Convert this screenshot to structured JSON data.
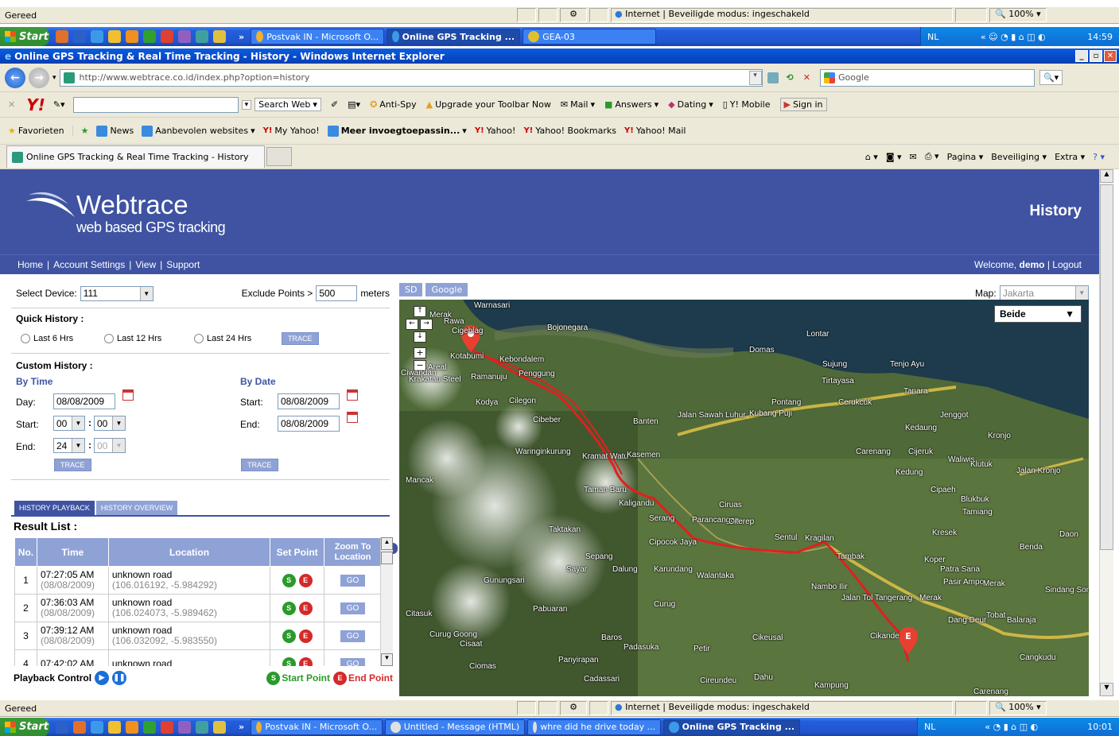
{
  "status_top": {
    "text": "Gereed",
    "zone": "Internet | Beveiligde modus: ingeschakeld",
    "zoom": "100%"
  },
  "taskbar_top": {
    "start": "Start",
    "tasks": [
      "Postvak IN - Microsoft O...",
      "Online GPS Tracking ...",
      "GEA-03"
    ],
    "lang": "NL",
    "clock": "14:59"
  },
  "window": {
    "title": "Online GPS Tracking & Real Time Tracking - History - Windows Internet Explorer"
  },
  "address": {
    "url": "http://www.webtrace.co.id/index.php?option=history",
    "search_placeholder": "Google"
  },
  "yahoo_toolbar": {
    "search_web": "Search Web",
    "anti_spy": "Anti-Spy",
    "upgrade": "Upgrade your Toolbar Now",
    "mail": "Mail",
    "answers": "Answers",
    "dating": "Dating",
    "mobile": "Y! Mobile",
    "signin": "Sign in"
  },
  "favorites": {
    "label": "Favorieten",
    "items": [
      "News",
      "Aanbevolen websites",
      "My Yahoo!",
      "Meer invoegtoepassin...",
      "Yahoo!",
      "Yahoo! Bookmarks",
      "Yahoo! Mail"
    ]
  },
  "tab": {
    "title": "Online GPS Tracking & Real Time Tracking - History",
    "cmd_page": "Pagina",
    "cmd_security": "Beveiliging",
    "cmd_extra": "Extra"
  },
  "site": {
    "brand": "Webtrace",
    "tagline": "web based GPS tracking",
    "page_title": "History",
    "nav": [
      "Home",
      "Account Settings",
      "View",
      "Support"
    ],
    "welcome": "Welcome,",
    "user": "demo",
    "logout": "Logout"
  },
  "form": {
    "select_device_label": "Select Device:",
    "device": "111",
    "exclude_label": "Exclude Points >",
    "exclude_value": "500",
    "exclude_unit": "meters",
    "quick_history": "Quick History :",
    "quick_options": [
      "Last 6 Hrs",
      "Last 12 Hrs",
      "Last 24 Hrs"
    ],
    "trace": "TRACE",
    "custom_history": "Custom History :",
    "by_time": "By Time",
    "by_date": "By Date",
    "day_label": "Day:",
    "day": "08/08/2009",
    "start_label": "Start:",
    "start_h": "00",
    "start_m": "00",
    "end_label": "End:",
    "end_h": "24",
    "end_m": "00",
    "date_start_label": "Start:",
    "date_start": "08/08/2009",
    "date_end_label": "End:",
    "date_end": "08/08/2009"
  },
  "results": {
    "tab_playback": "HISTORY PLAYBACK",
    "tab_overview": "HISTORY OVERVIEW",
    "title": "Result List :",
    "headers": [
      "No.",
      "Time",
      "Location",
      "Set Point",
      "Zoom To Location"
    ],
    "rows": [
      {
        "no": "1",
        "time": "07:27:05 AM",
        "date": "(08/08/2009)",
        "loc": "unknown road",
        "coords": "(106.016192, -5.984292)"
      },
      {
        "no": "2",
        "time": "07:36:03 AM",
        "date": "(08/08/2009)",
        "loc": "unknown road",
        "coords": "(106.024073, -5.989462)"
      },
      {
        "no": "3",
        "time": "07:39:12 AM",
        "date": "(08/08/2009)",
        "loc": "unknown road",
        "coords": "(106.032092, -5.983550)"
      },
      {
        "no": "4",
        "time": "07:42:02 AM",
        "date": "",
        "loc": "unknown road",
        "coords": ""
      }
    ],
    "go": "GO",
    "s": "S",
    "e": "E",
    "playback_control": "Playback Control",
    "start_point": "Start Point",
    "end_point": "End Point"
  },
  "map": {
    "btn_sd": "SD",
    "btn_google": "Google",
    "map_label": "Map:",
    "map_value": "Jakarta",
    "view_type": "Beide",
    "places": [
      "Merak",
      "Bojonegara",
      "Lontar",
      "Domas",
      "Sujung",
      "Tenjo Ayu",
      "Tirtayasa",
      "Tanara",
      "Cilegon",
      "Kodya",
      "Ramanuju",
      "Kebondalem",
      "Penggung",
      "Cibeber",
      "Banten",
      "Jalan Sawah Luhur",
      "Kubang Puji",
      "Pontang",
      "Cerukcuk",
      "Jenggot",
      "Kedaung",
      "Kronjo",
      "Carenang",
      "Cijeruk",
      "Waringinkurung",
      "Kramat Watu",
      "Kasemen",
      "Mancak",
      "Taman Baru",
      "Kaligandu",
      "Ciruas",
      "Serang",
      "Parancangan",
      "Citerep",
      "Taktakan",
      "Cipocok Jaya",
      "Sepang",
      "Sayar",
      "Dalung",
      "Karundang",
      "Walantaka",
      "Sentul",
      "Kragilan",
      "Tambak",
      "Kresek",
      "Benda",
      "Patra Sana",
      "Pasir Ampo",
      "Merak",
      "Gunungsari",
      "Pabuaran",
      "Curug",
      "Nambo Ilir",
      "Jalan Tol Tangerang - Merak",
      "Citasuk",
      "Curug Goong",
      "Cisaat",
      "Baros",
      "Padasuka",
      "Petir",
      "Cikeusal",
      "Cikande",
      "Dang Deur",
      "Tobat",
      "Balaraja",
      "Cangkudu",
      "Ciomas",
      "Panyirapan",
      "Cadassari",
      "Cireundeu",
      "Dahu",
      "Kampung",
      "Carenang",
      "Waliwis",
      "Klutuk",
      "Cipaeh",
      "Blukbuk",
      "Tamiang",
      "Kedung",
      "Koper",
      "Sindang Sono",
      "Rawa",
      "Kotabumi",
      "Areal",
      "Krakatau Steel",
      "Ciwandan",
      "Warnasari",
      "Cigeblag",
      "Jalan Kronjo",
      "Daon"
    ]
  },
  "status_bottom": {
    "text": "Gereed",
    "zone": "Internet | Beveiligde modus: ingeschakeld",
    "zoom": "100%"
  },
  "taskbar_bottom": {
    "start": "Start",
    "tasks": [
      "Postvak IN - Microsoft O...",
      "Untitled - Message (HTML)",
      "whre did he drive today ...",
      "Online GPS Tracking ..."
    ],
    "lang": "NL",
    "clock": "10:01"
  },
  "colors": {
    "brand_blue": "#3f53a2",
    "button_blue": "#8fa2d6",
    "route_red": "#e02020",
    "start_green": "#2a9a2a",
    "end_red": "#d42a2a"
  }
}
